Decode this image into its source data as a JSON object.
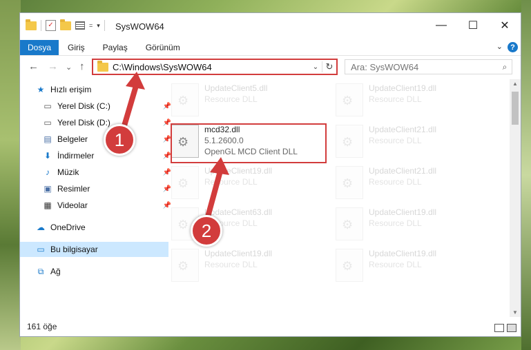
{
  "window": {
    "title": "SysWOW64",
    "minimize": "—",
    "maximize": "☐",
    "close": "✕"
  },
  "quick_access_toolbar": {
    "dropdown": "▾",
    "pin_symbol": "="
  },
  "ribbon": {
    "tabs": [
      "Dosya",
      "Giriş",
      "Paylaş",
      "Görünüm"
    ],
    "help": "?",
    "expand": "⌄"
  },
  "navigation": {
    "back": "←",
    "forward": "→",
    "recent": "⌄",
    "up": "↑",
    "address": "C:\\Windows\\SysWOW64",
    "refresh": "↻",
    "address_dropdown": "⌄",
    "search_placeholder": "Ara: SysWOW64"
  },
  "sidebar": {
    "items": [
      {
        "label": "Hızlı erişim",
        "icon": "star-icon"
      },
      {
        "label": "Yerel Disk (C:)",
        "icon": "drive-icon",
        "pinned": true
      },
      {
        "label": "Yerel Disk (D:)",
        "icon": "drive-icon",
        "pinned": true
      },
      {
        "label": "Belgeler",
        "icon": "document-icon",
        "pinned": true
      },
      {
        "label": "İndirmeler",
        "icon": "download-icon",
        "pinned": true
      },
      {
        "label": "Müzik",
        "icon": "music-icon",
        "pinned": true
      },
      {
        "label": "Resimler",
        "icon": "picture-icon",
        "pinned": true
      },
      {
        "label": "Videolar",
        "icon": "video-icon",
        "pinned": true
      },
      {
        "label": "OneDrive",
        "icon": "cloud-icon"
      },
      {
        "label": "Bu bilgisayar",
        "icon": "computer-icon",
        "selected": true
      },
      {
        "label": "Ağ",
        "icon": "network-icon"
      }
    ]
  },
  "files": {
    "highlighted": {
      "name": "mcd32.dll",
      "version": "5.1.2600.0",
      "description": "OpenGL MCD Client DLL"
    },
    "faded": [
      {
        "name": "UpdateClient5.dll",
        "type": "Resource DLL"
      },
      {
        "name": "UpdateClient19.dll",
        "type": "Resource DLL"
      },
      {
        "name": "UpdateClient21.dll",
        "type": "Resource DLL"
      },
      {
        "name": "UpdateClient19.dll",
        "type": "Resource DLL"
      },
      {
        "name": "UpdateClient21.dll",
        "type": "Resource DLL"
      },
      {
        "name": "UpdateClient63.dll",
        "type": "Resource DLL"
      },
      {
        "name": "UpdateClient19.dll",
        "type": "Resource DLL"
      },
      {
        "name": "UpdateClient19.dll",
        "type": "Resource DLL"
      },
      {
        "name": "UpdateClient19.dll",
        "type": "Resource DLL"
      }
    ]
  },
  "status_bar": {
    "item_count": "161 öğe"
  },
  "annotations": {
    "step1": "1",
    "step2": "2"
  },
  "colors": {
    "accent": "#1979ca",
    "annotation_red": "#d23c3c",
    "selected_bg": "#cce8ff"
  }
}
